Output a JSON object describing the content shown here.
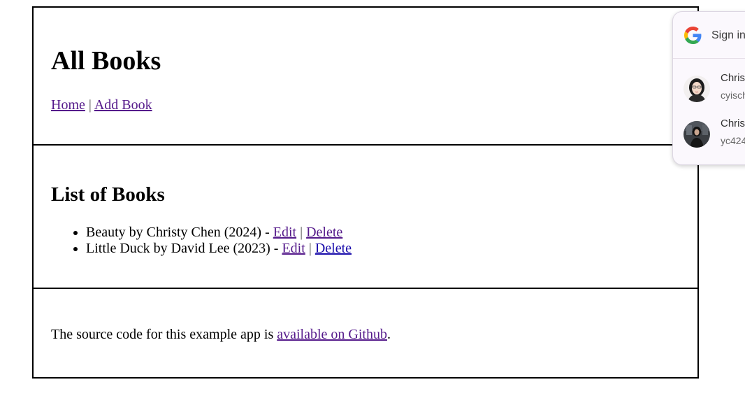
{
  "header": {
    "title": "All Books",
    "nav_home": "Home",
    "nav_separator": "|",
    "nav_add_book": "Add Book"
  },
  "list": {
    "title": "List of Books",
    "items": [
      {
        "text": "Beauty by Christy Chen (2024) - ",
        "edit": "Edit",
        "separator": "|",
        "delete": "Delete"
      },
      {
        "text": "Little Duck by David Lee (2023) - ",
        "edit": "Edit",
        "separator": "|",
        "delete": "Delete"
      }
    ]
  },
  "footer": {
    "text_before": "The source code for this example app is ",
    "link": "available on Github",
    "text_after": "."
  },
  "google_popup": {
    "title": "Sign in",
    "accounts": [
      {
        "name": "Christ",
        "email": "cyisch",
        "avatar_icon": "profile-photo-icon"
      },
      {
        "name": "Christ",
        "email": "yc424",
        "avatar_icon": "profile-photo-icon"
      }
    ]
  },
  "colors": {
    "visited_link": "#551a8b",
    "unvisited_link": "#1a0dab",
    "border": "#000000",
    "popup_bg": "#fbf8fd"
  }
}
